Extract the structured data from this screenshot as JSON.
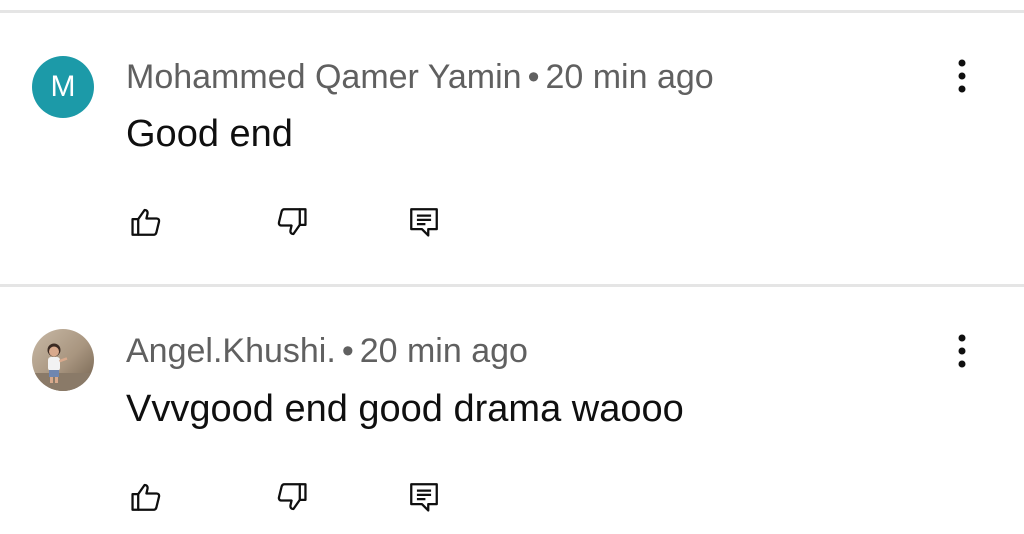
{
  "comments": [
    {
      "author": "Mohammed Qamer Yamin",
      "separator": "•",
      "time": "20 min ago",
      "text": "Good end",
      "avatar": {
        "type": "letter",
        "letter": "M",
        "color": "#1c9aa8"
      },
      "icons": {
        "like": "thumbs-up-icon",
        "dislike": "thumbs-down-icon",
        "reply": "reply-icon",
        "menu": "more-vert-icon"
      }
    },
    {
      "author": "Angel.Khushi.",
      "separator": "•",
      "time": "20 min ago",
      "text": "Vvvgood end good drama waooo",
      "avatar": {
        "type": "photo"
      },
      "icons": {
        "like": "thumbs-up-icon",
        "dislike": "thumbs-down-icon",
        "reply": "reply-icon",
        "menu": "more-vert-icon"
      }
    }
  ],
  "colors": {
    "meta_text": "#606060",
    "body_text": "#0f0f0f",
    "divider": "#e5e5e5",
    "icon": "#0f0f0f"
  }
}
